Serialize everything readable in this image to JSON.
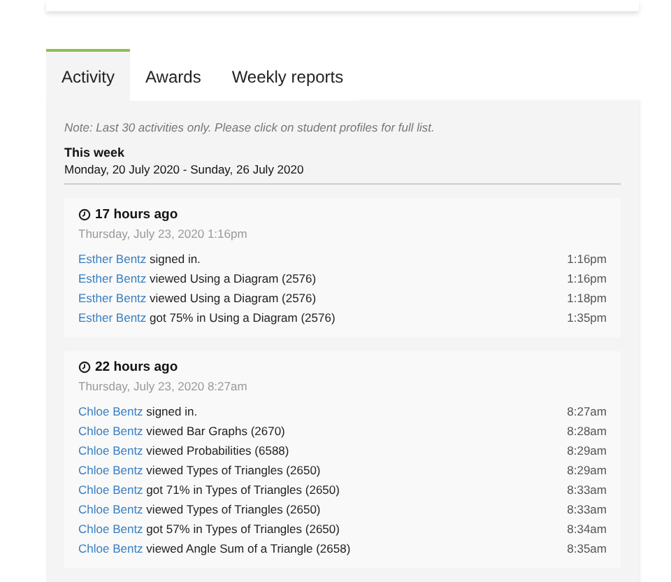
{
  "tabs": [
    {
      "label": "Activity",
      "selected": true
    },
    {
      "label": "Awards",
      "selected": false
    },
    {
      "label": "Weekly reports",
      "selected": false
    }
  ],
  "note": "Note: Last 30 activities only. Please click on student profiles for full list.",
  "week": {
    "title": "This week",
    "range": "Monday, 20 July 2020 - Sunday, 26 July 2020"
  },
  "groups": [
    {
      "ago": "17 hours ago",
      "date": "Thursday, July 23, 2020 1:16pm",
      "items": [
        {
          "student": "Esther Bentz",
          "action": "signed in.",
          "time": "1:16pm"
        },
        {
          "student": "Esther Bentz",
          "action": "viewed Using a Diagram (2576)",
          "time": "1:16pm"
        },
        {
          "student": "Esther Bentz",
          "action": "viewed Using a Diagram (2576)",
          "time": "1:18pm"
        },
        {
          "student": "Esther Bentz",
          "action": "got 75% in Using a Diagram (2576)",
          "time": "1:35pm"
        }
      ]
    },
    {
      "ago": "22 hours ago",
      "date": "Thursday, July 23, 2020 8:27am",
      "items": [
        {
          "student": "Chloe Bentz",
          "action": "signed in.",
          "time": "8:27am"
        },
        {
          "student": "Chloe Bentz",
          "action": "viewed Bar Graphs (2670)",
          "time": "8:28am"
        },
        {
          "student": "Chloe Bentz",
          "action": "viewed Probabilities (6588)",
          "time": "8:29am"
        },
        {
          "student": "Chloe Bentz",
          "action": "viewed Types of Triangles (2650)",
          "time": "8:29am"
        },
        {
          "student": "Chloe Bentz",
          "action": "got 71% in Types of Triangles (2650)",
          "time": "8:33am"
        },
        {
          "student": "Chloe Bentz",
          "action": "viewed Types of Triangles (2650)",
          "time": "8:33am"
        },
        {
          "student": "Chloe Bentz",
          "action": "got 57% in Types of Triangles (2650)",
          "time": "8:34am"
        },
        {
          "student": "Chloe Bentz",
          "action": "viewed Angle Sum of a Triangle (2658)",
          "time": "8:35am"
        }
      ]
    }
  ]
}
